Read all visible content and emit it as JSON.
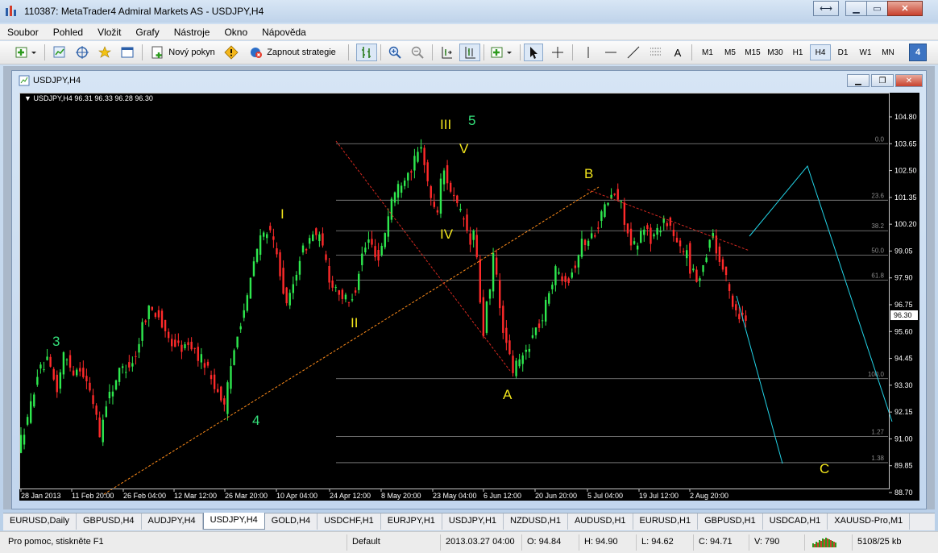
{
  "app": {
    "title": "110387: MetaTrader4 Admiral Markets AS - USDJPY,H4"
  },
  "menu": [
    "Soubor",
    "Pohled",
    "Vložit",
    "Grafy",
    "Nástroje",
    "Okno",
    "Nápověda"
  ],
  "toolbar": {
    "new_order_label": "Nový pokyn",
    "autotrading_label": "Zapnout strategie",
    "text_tool_label": "A",
    "timeframes": [
      "M1",
      "M5",
      "M15",
      "M30",
      "H1",
      "H4",
      "D1",
      "W1",
      "MN"
    ],
    "active_timeframe": "H4",
    "badge": "4"
  },
  "chart_window": {
    "title": "USDJPY,H4",
    "header_symbol": "USDJPY,H4",
    "header_ohlc": "96.31 96.33 96.28 96.30"
  },
  "chart_data": {
    "type": "candlestick",
    "symbol": "USDJPY",
    "timeframe": "H4",
    "price_axis": [
      "104.80",
      "103.65",
      "102.50",
      "101.35",
      "100.20",
      "99.05",
      "97.90",
      "96.75",
      "95.60",
      "94.45",
      "93.30",
      "92.15",
      "91.00",
      "89.85",
      "88.70"
    ],
    "current_price": "96.30",
    "time_axis": [
      "28 Jan 2013",
      "11 Feb 20:00",
      "26 Feb 04:00",
      "12 Mar 12:00",
      "26 Mar 20:00",
      "10 Apr 04:00",
      "24 Apr 12:00",
      "8 May 20:00",
      "23 May 04:00",
      "6 Jun 12:00",
      "20 Jun 20:00",
      "5 Jul 04:00",
      "19 Jul 12:00",
      "2 Aug 20:00"
    ],
    "path": [
      [
        0,
        90.6
      ],
      [
        3,
        91.8
      ],
      [
        6,
        93.8
      ],
      [
        9,
        94.3
      ],
      [
        12,
        93.1
      ],
      [
        14,
        94.6
      ],
      [
        17,
        93.9
      ],
      [
        19,
        94.1
      ],
      [
        21,
        93.4
      ],
      [
        24,
        92.1
      ],
      [
        25,
        91.1
      ],
      [
        27,
        92.6
      ],
      [
        29,
        93.2
      ],
      [
        31,
        93.9
      ],
      [
        34,
        94.2
      ],
      [
        36,
        94.5
      ],
      [
        38,
        95.9
      ],
      [
        40,
        96.6
      ],
      [
        43,
        96.3
      ],
      [
        45,
        95.4
      ],
      [
        47,
        95.1
      ],
      [
        50,
        94.9
      ],
      [
        53,
        95.0
      ],
      [
        55,
        94.5
      ],
      [
        57,
        94.3
      ],
      [
        60,
        93.3
      ],
      [
        62,
        92.8
      ],
      [
        63,
        92.3
      ],
      [
        64,
        93.2
      ],
      [
        65,
        94.1
      ],
      [
        67,
        95.6
      ],
      [
        70,
        97.0
      ],
      [
        72,
        98.6
      ],
      [
        74,
        99.6
      ],
      [
        76,
        100.0
      ],
      [
        78,
        99.4
      ],
      [
        80,
        98.2
      ],
      [
        81,
        97.4
      ],
      [
        82,
        96.6
      ],
      [
        84,
        97.6
      ],
      [
        86,
        98.8
      ],
      [
        88,
        99.3
      ],
      [
        90,
        99.8
      ],
      [
        92,
        99.6
      ],
      [
        94,
        98.6
      ],
      [
        95,
        97.8
      ],
      [
        97,
        97.5
      ],
      [
        99,
        97.1
      ],
      [
        101,
        96.8
      ],
      [
        103,
        97.5
      ],
      [
        105,
        98.9
      ],
      [
        107,
        99.5
      ],
      [
        109,
        99.0
      ],
      [
        110,
        98.7
      ],
      [
        112,
        99.9
      ],
      [
        114,
        101.3
      ],
      [
        116,
        101.8
      ],
      [
        118,
        102.3
      ],
      [
        120,
        102.6
      ],
      [
        122,
        103.2
      ],
      [
        123,
        103.4
      ],
      [
        124,
        102.9
      ],
      [
        126,
        101.2
      ],
      [
        128,
        100.8
      ],
      [
        129,
        102.0
      ],
      [
        130,
        102.5
      ],
      [
        132,
        101.7
      ],
      [
        134,
        100.9
      ],
      [
        136,
        100.4
      ],
      [
        138,
        99.3
      ],
      [
        139,
        99.9
      ],
      [
        140,
        98.6
      ],
      [
        141,
        96.9
      ],
      [
        142,
        95.5
      ],
      [
        143,
        96.8
      ],
      [
        144,
        97.2
      ],
      [
        145,
        98.9
      ],
      [
        146,
        98.0
      ],
      [
        147,
        96.5
      ],
      [
        149,
        95.0
      ],
      [
        151,
        93.9
      ],
      [
        152,
        94.2
      ],
      [
        154,
        94.5
      ],
      [
        156,
        95.1
      ],
      [
        158,
        95.7
      ],
      [
        160,
        96.1
      ],
      [
        162,
        97.4
      ],
      [
        164,
        98.2
      ],
      [
        166,
        98.0
      ],
      [
        168,
        97.9
      ],
      [
        170,
        98.5
      ],
      [
        172,
        99.4
      ],
      [
        174,
        99.5
      ],
      [
        176,
        99.9
      ],
      [
        178,
        100.6
      ],
      [
        180,
        101.2
      ],
      [
        182,
        101.5
      ],
      [
        184,
        101.0
      ],
      [
        186,
        99.8
      ],
      [
        187,
        99.2
      ],
      [
        189,
        99.3
      ],
      [
        191,
        100.2
      ],
      [
        193,
        99.5
      ],
      [
        195,
        99.9
      ],
      [
        197,
        100.4
      ],
      [
        199,
        100.1
      ],
      [
        201,
        99.3
      ],
      [
        203,
        98.9
      ],
      [
        204,
        99.2
      ],
      [
        205,
        98.3
      ],
      [
        207,
        97.8
      ],
      [
        209,
        98.4
      ],
      [
        211,
        99.6
      ],
      [
        212,
        99.9
      ],
      [
        213,
        99.0
      ],
      [
        215,
        98.3
      ],
      [
        216,
        97.8
      ],
      [
        218,
        96.8
      ],
      [
        220,
        96.3
      ],
      [
        222,
        96.2
      ]
    ],
    "fibonacci_levels": [
      "0.0",
      "23.6",
      "38.2",
      "50.0",
      "61.8",
      "100.0",
      "1.27",
      "1.38"
    ],
    "wave_labels": [
      {
        "text": "3",
        "color": "#34e07a"
      },
      {
        "text": "4",
        "color": "#34e07a"
      },
      {
        "text": "5",
        "color": "#34e07a"
      },
      {
        "text": "I",
        "color": "#f2e51c"
      },
      {
        "text": "II",
        "color": "#f2e51c"
      },
      {
        "text": "III",
        "color": "#f2e51c"
      },
      {
        "text": "IV",
        "color": "#f2e51c"
      },
      {
        "text": "V",
        "color": "#f2e51c"
      },
      {
        "text": "A",
        "color": "#f2e51c"
      },
      {
        "text": "B",
        "color": "#f2e51c"
      },
      {
        "text": "C",
        "color": "#f2e51c"
      },
      {
        "text": "A",
        "color": "#f2e51c"
      },
      {
        "text": "B",
        "color": "#f2e51c"
      }
    ],
    "colors": {
      "bull": "#2ee84e",
      "bear": "#ff2a2a",
      "background": "#000000",
      "fib": "#8c8c8c",
      "trendline": "#ff8c1a",
      "projection": "#22d3e6"
    }
  },
  "tabs": [
    "EURUSD,Daily",
    "GBPUSD,H4",
    "AUDJPY,H4",
    "USDJPY,H4",
    "GOLD,H4",
    "USDCHF,H1",
    "EURJPY,H1",
    "USDJPY,H1",
    "NZDUSD,H1",
    "AUDUSD,H1",
    "EURUSD,H1",
    "GBPUSD,H1",
    "USDCAD,H1",
    "XAUUSD-Pro,M1"
  ],
  "active_tab": "USDJPY,H4",
  "status": {
    "help": "Pro pomoc, stiskněte F1",
    "profile": "Default",
    "datetime": "2013.03.27 04:00",
    "open": "O: 94.84",
    "high": "H: 94.90",
    "low": "L: 94.62",
    "close": "C: 94.71",
    "volume": "V: 790",
    "traffic": "5108/25 kb"
  }
}
